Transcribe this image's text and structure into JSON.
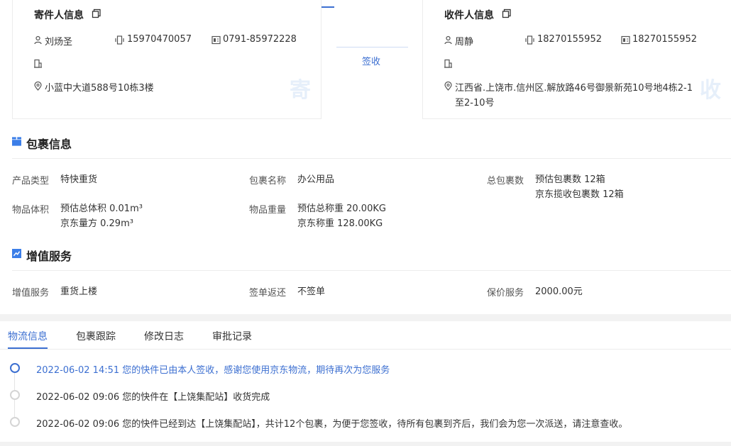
{
  "sender": {
    "title": "寄件人信息",
    "name": "刘炀圣",
    "mobile": "15970470057",
    "phone": "0791-85972228",
    "address": "小蓝中大道588号10栋3楼",
    "badge": "寄"
  },
  "status": {
    "label": "签收"
  },
  "receiver": {
    "title": "收件人信息",
    "name": "周静",
    "mobile": "18270155952",
    "phone": "18270155952",
    "address_line1": "江西省.上饶市.信州区.解放路46号御景新苑10号地4栋2-1",
    "address_line2": "至2-10号",
    "badge": "收"
  },
  "package": {
    "title": "包裹信息",
    "product_type_label": "产品类型",
    "product_type": "特快重货",
    "package_name_label": "包裹名称",
    "package_name": "办公用品",
    "total_count_label": "总包裹数",
    "total_count_est": "预估包裹数 12箱",
    "total_count_jd": "京东揽收包裹数 12箱",
    "volume_label": "物品体积",
    "volume_est": "预估总体积 0.01m³",
    "volume_jd": "京东量方 0.29m³",
    "weight_label": "物品重量",
    "weight_est": "预估总称重 20.00KG",
    "weight_jd": "京东称重 128.00KG"
  },
  "value_added": {
    "title": "增值服务",
    "service_label": "增值服务",
    "service": "重货上楼",
    "sign_return_label": "签单返还",
    "sign_return": "不签单",
    "insured_label": "保价服务",
    "insured": "2000.00元"
  },
  "tabs": [
    {
      "label": "物流信息"
    },
    {
      "label": "包裹跟踪"
    },
    {
      "label": "修改日志"
    },
    {
      "label": "审批记录"
    }
  ],
  "timeline": [
    {
      "text": "2022-06-02 14:51 您的快件已由本人签收，感谢您使用京东物流，期待再次为您服务"
    },
    {
      "text": "2022-06-02 09:06 您的快件在【上饶集配站】收货完成"
    },
    {
      "text": "2022-06-02 09:06 您的快件已经到达【上饶集配站】，共计12个包裹，为便于您签收，待所有包裹到齐后，我们会为您一次派送，请注意查收。"
    }
  ],
  "colors": {
    "accent": "#3c6fd1",
    "section_icon": "#3b7ee8",
    "badge_watermark": "#e6effa"
  }
}
